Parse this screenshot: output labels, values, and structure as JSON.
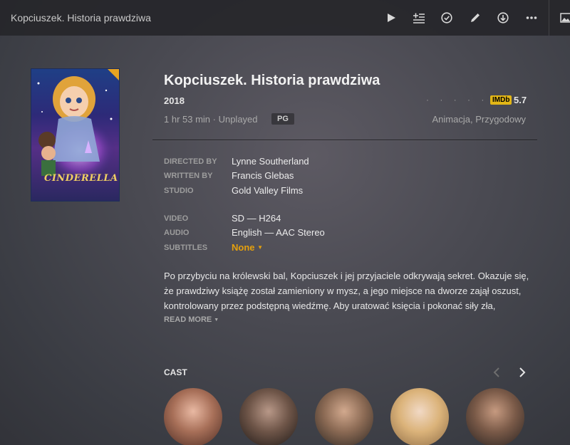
{
  "header": {
    "title": "Kopciuszek. Historia prawdziwa",
    "icons": [
      "play-icon",
      "add-to-queue-icon",
      "mark-watched-icon",
      "edit-icon",
      "download-icon",
      "more-icon",
      "image-icon"
    ]
  },
  "movie": {
    "title": "Kopciuszek. Historia prawdziwa",
    "year": "2018",
    "rating_dots": "· · · · ·",
    "imdb_label": "IMDb",
    "imdb_score": "5.7",
    "meta": "1 hr 53 min · Unplayed",
    "content_rating": "PG",
    "genres": "Animacja, Przygodowy",
    "poster_text": "CINDERELLA"
  },
  "details": {
    "directed_by_label": "DIRECTED BY",
    "directed_by": "Lynne Southerland",
    "written_by_label": "WRITTEN BY",
    "written_by": "Francis Glebas",
    "studio_label": "STUDIO",
    "studio": "Gold Valley Films",
    "video_label": "VIDEO",
    "video": "SD — H264",
    "audio_label": "AUDIO",
    "audio": "English — AAC Stereo",
    "subtitles_label": "SUBTITLES",
    "subtitles": "None"
  },
  "summary": {
    "text": "Po przybyciu na królewski bal, Kopciuszek i jej przyjaciele odkrywają sekret. Okazuje się, że prawdziwy książę został zamieniony w mysz, a jego miejsce na dworze zajął oszust, kontrolowany przez podstępną wiedźmę. Aby uratować księcia i pokonać siły zła,",
    "read_more": "READ MORE"
  },
  "cast": {
    "title": "CAST",
    "colors": {
      "accent": "#e5a00d",
      "imdb": "#e2b616"
    }
  }
}
